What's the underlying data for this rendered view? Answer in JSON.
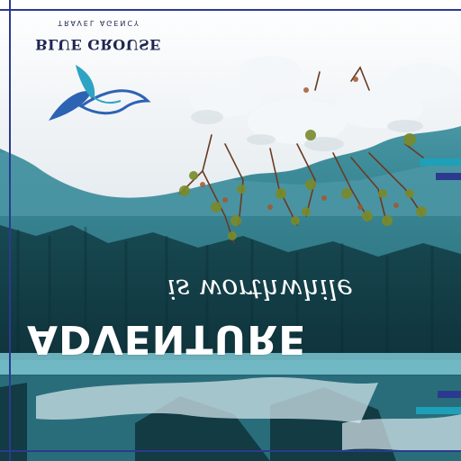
{
  "brand": {
    "name": "BLUE GROUSE",
    "subtitle": "TRAVEL AGENCY"
  },
  "headline": "ADVENTURE",
  "tagline": "is worthwhile",
  "colors": {
    "frame": "#2b3a8f",
    "bar_teal": "#1ea0b8",
    "bar_navy": "#2b3a8f",
    "logo_blue": "#2d63b3",
    "logo_teal": "#2fa3c4",
    "text_white": "#ffffff",
    "text_navy": "#1d2650"
  },
  "icons": {
    "logo": "grouse-bird-icon"
  }
}
